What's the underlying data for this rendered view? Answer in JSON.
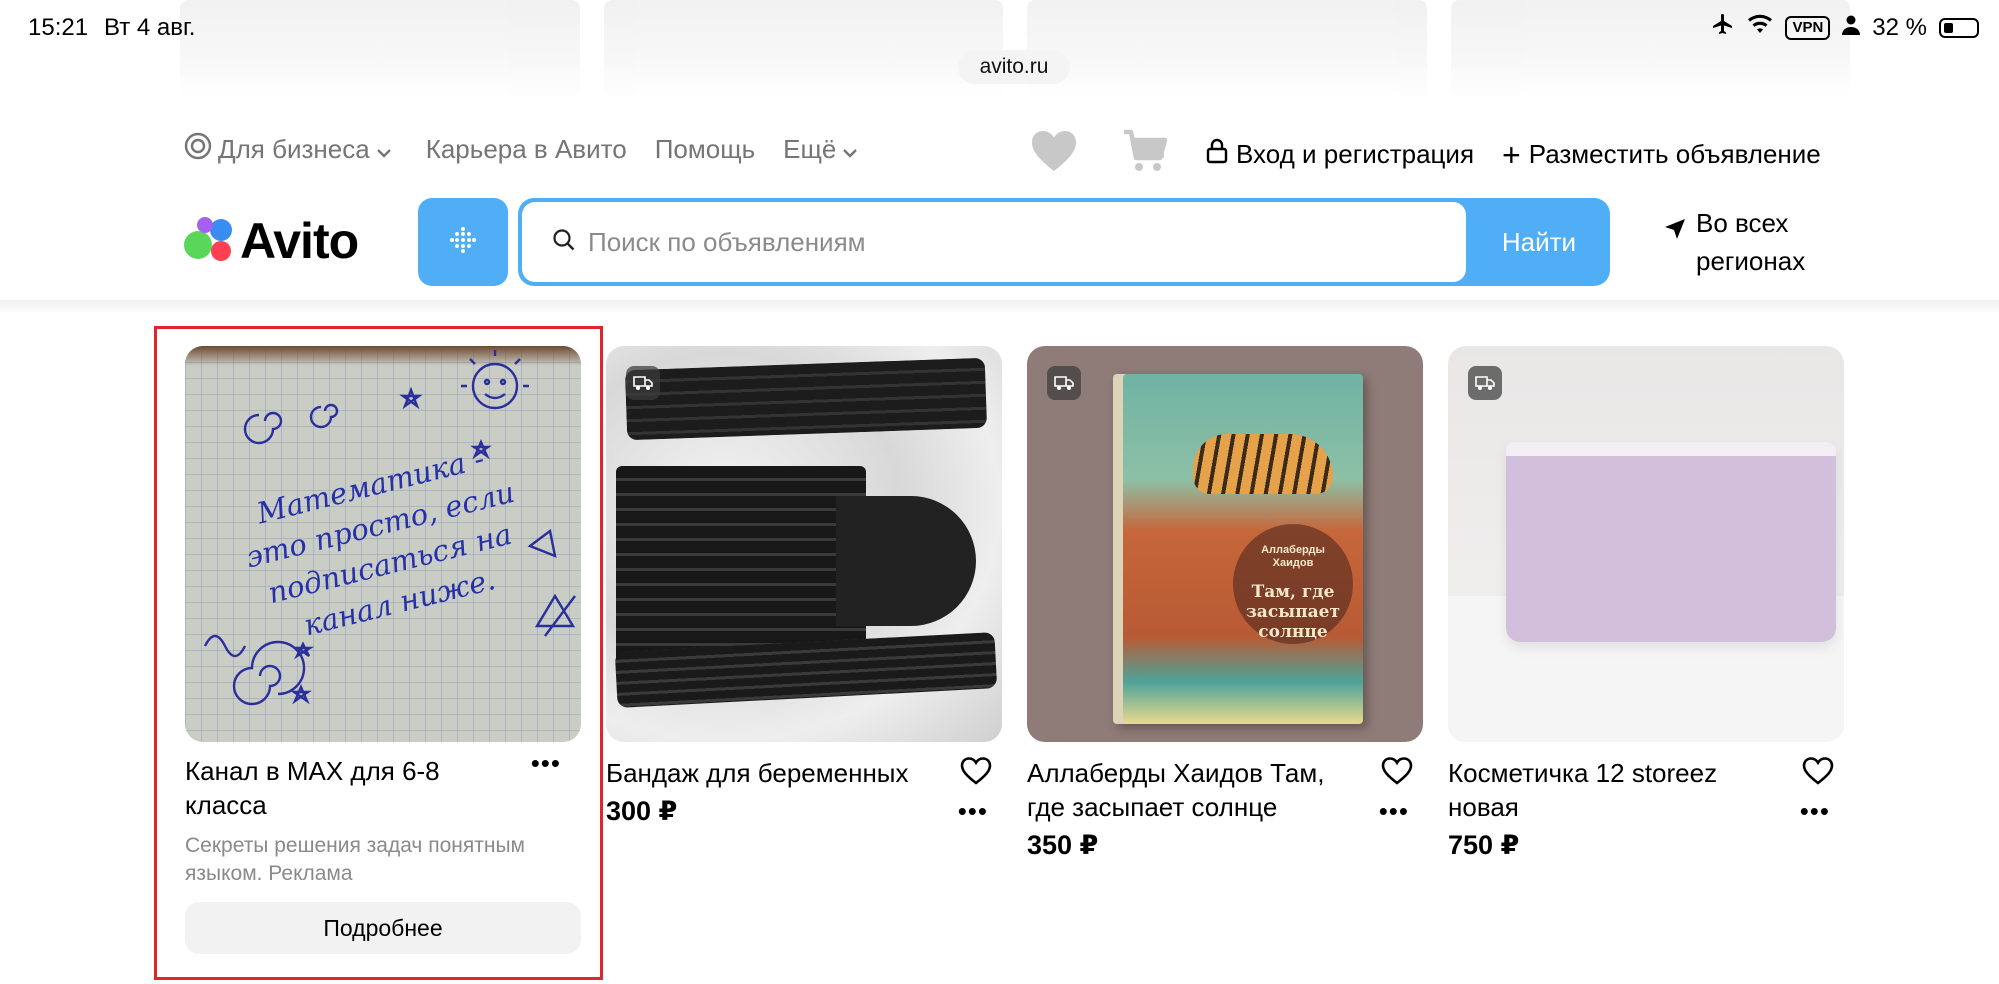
{
  "status_bar": {
    "time": "15:21",
    "date": "Вт 4 авг.",
    "vpn": "VPN",
    "battery": "32 %"
  },
  "browser": {
    "url": "avito.ru"
  },
  "top_nav": {
    "business": "Для бизнеса",
    "career": "Карьера в Авито",
    "help": "Помощь",
    "more": "Ещё"
  },
  "header_actions": {
    "login": "Вход и регистрация",
    "post_ad": "Разместить объявление"
  },
  "logo": {
    "text": "Avito",
    "dot_colors": [
      "#5ad75a",
      "#3a8df0",
      "#a560f0",
      "#ff4053"
    ]
  },
  "search": {
    "placeholder": "Поиск по объявлениям",
    "button": "Найти"
  },
  "region": {
    "line1": "Во всех",
    "line2": "регионах"
  },
  "colors": {
    "accent": "#4faef5",
    "ad_highlight": "#e0262b"
  },
  "ad_card": {
    "title": "Канал в MAX для 6-8 класса",
    "subtitle": "Секреты решения задач понятным языком. Реклама",
    "button": "Подробнее",
    "image_text": "Математика - это просто, если подписаться на канал ниже."
  },
  "listings": [
    {
      "title": "Бандаж для беременных",
      "price": "300 ₽"
    },
    {
      "title": "Аллаберды Хаидов Там, где засыпает солнце",
      "price": "350 ₽",
      "cover_author": "Аллаберды Хаидов",
      "cover_title": "Там, где засыпает солнце"
    },
    {
      "title": "Косметичка 12 storeez новая",
      "price": "750 ₽"
    }
  ]
}
